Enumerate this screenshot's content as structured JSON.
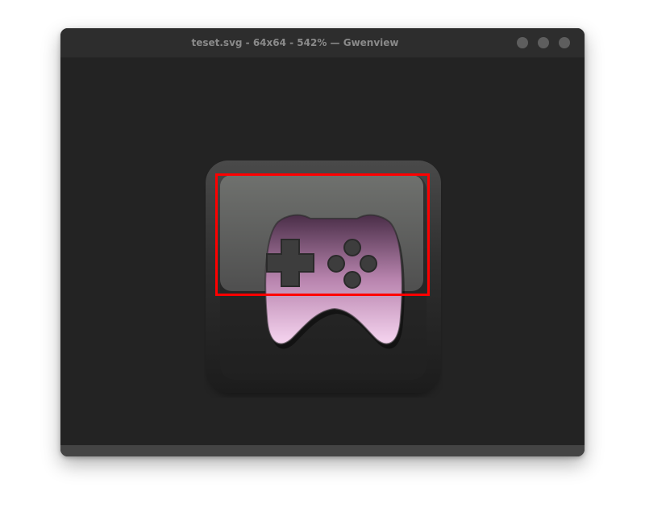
{
  "window": {
    "title": "teset.svg - 64x64 - 542% — Gwenview",
    "app": "Gwenview"
  },
  "image": {
    "file_name": "teset.svg",
    "dimensions": "64x64",
    "zoom": "542%",
    "icon": "gamepad-icon",
    "gradient_colors": [
      "#4a2e48",
      "#c98ebf",
      "#f6d5f0"
    ]
  },
  "selection": {
    "color": "#ff0000"
  },
  "colors": {
    "background": "#232323",
    "titlebar": "#2d2d2d",
    "title_text": "#8a8a8a",
    "window_button": "#5e5e5e"
  }
}
